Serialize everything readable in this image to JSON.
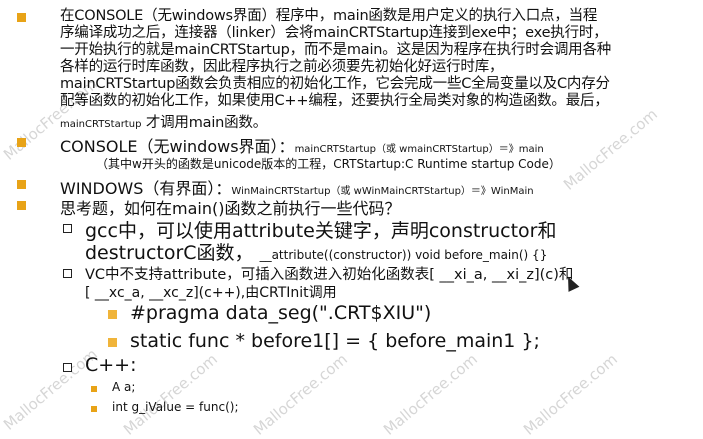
{
  "watermark": "MallocFree.com",
  "para1": {
    "line1": "在CONSOLE（无windows界面）程序中，main函数是用户定义的执行入口点，当程",
    "line2": "序编译成功之后，连接器（linker）会将mainCRTStartup连接到exe中；exe执行时，",
    "line3": "一开始执行的就是mainCRTStartup，而不是main。这是因为程序在执行时会调用各种",
    "line4": "各样的运行时库函数，因此程序执行之前必须要先初始化好运行时库，",
    "line5": "mainCRTStartup函数会负责相应的初始化工作，它会完成一些C全局变量以及C内存分",
    "line6": "配等函数的初始化工作，如果使用C++编程，还要执行全局类对象的构造函数。最后，",
    "line7_small": "mainCRTStartup",
    "line7_rest": " 才调用main函数。"
  },
  "console_item": {
    "label": "CONSOLE（无windows界面）：",
    "detail": "mainCRTStartup（或 wmainCRTStartup）＝》main",
    "note": "（其中w开头的函数是unicode版本的工程，CRTStartup:C Runtime startup Code）"
  },
  "windows_item": {
    "label": "WINDOWS（有界面）：",
    "detail": "WinMainCRTStartup（或 wWinMainCRTStartup）＝》WinMain"
  },
  "question": "思考题，如何在main()函数之前执行一些代码？",
  "gcc": {
    "line1": "gcc中，可以使用attribute关键字，声明constructor和",
    "line2_a": "destructorC函数，",
    "line2_b": "__attribute((constructor)) void before_main() {}"
  },
  "vc": {
    "line1": "VC中不支持attribute，可插入函数进入初始化函数表[ __xi_a, __xi_z](c)和",
    "line2": "[ __xc_a, __xc_z](c++),由CRTInit调用"
  },
  "pragma": "#pragma data_seg(\".CRT$XIU\")",
  "static_func": "static func * before1[] = { before_main1 };",
  "cpp": {
    "label": "C++:",
    "item1": "A a;",
    "item2": "int g_iValue = func();"
  },
  "colors": {
    "bullet": "#e8a317",
    "text": "#111111"
  }
}
